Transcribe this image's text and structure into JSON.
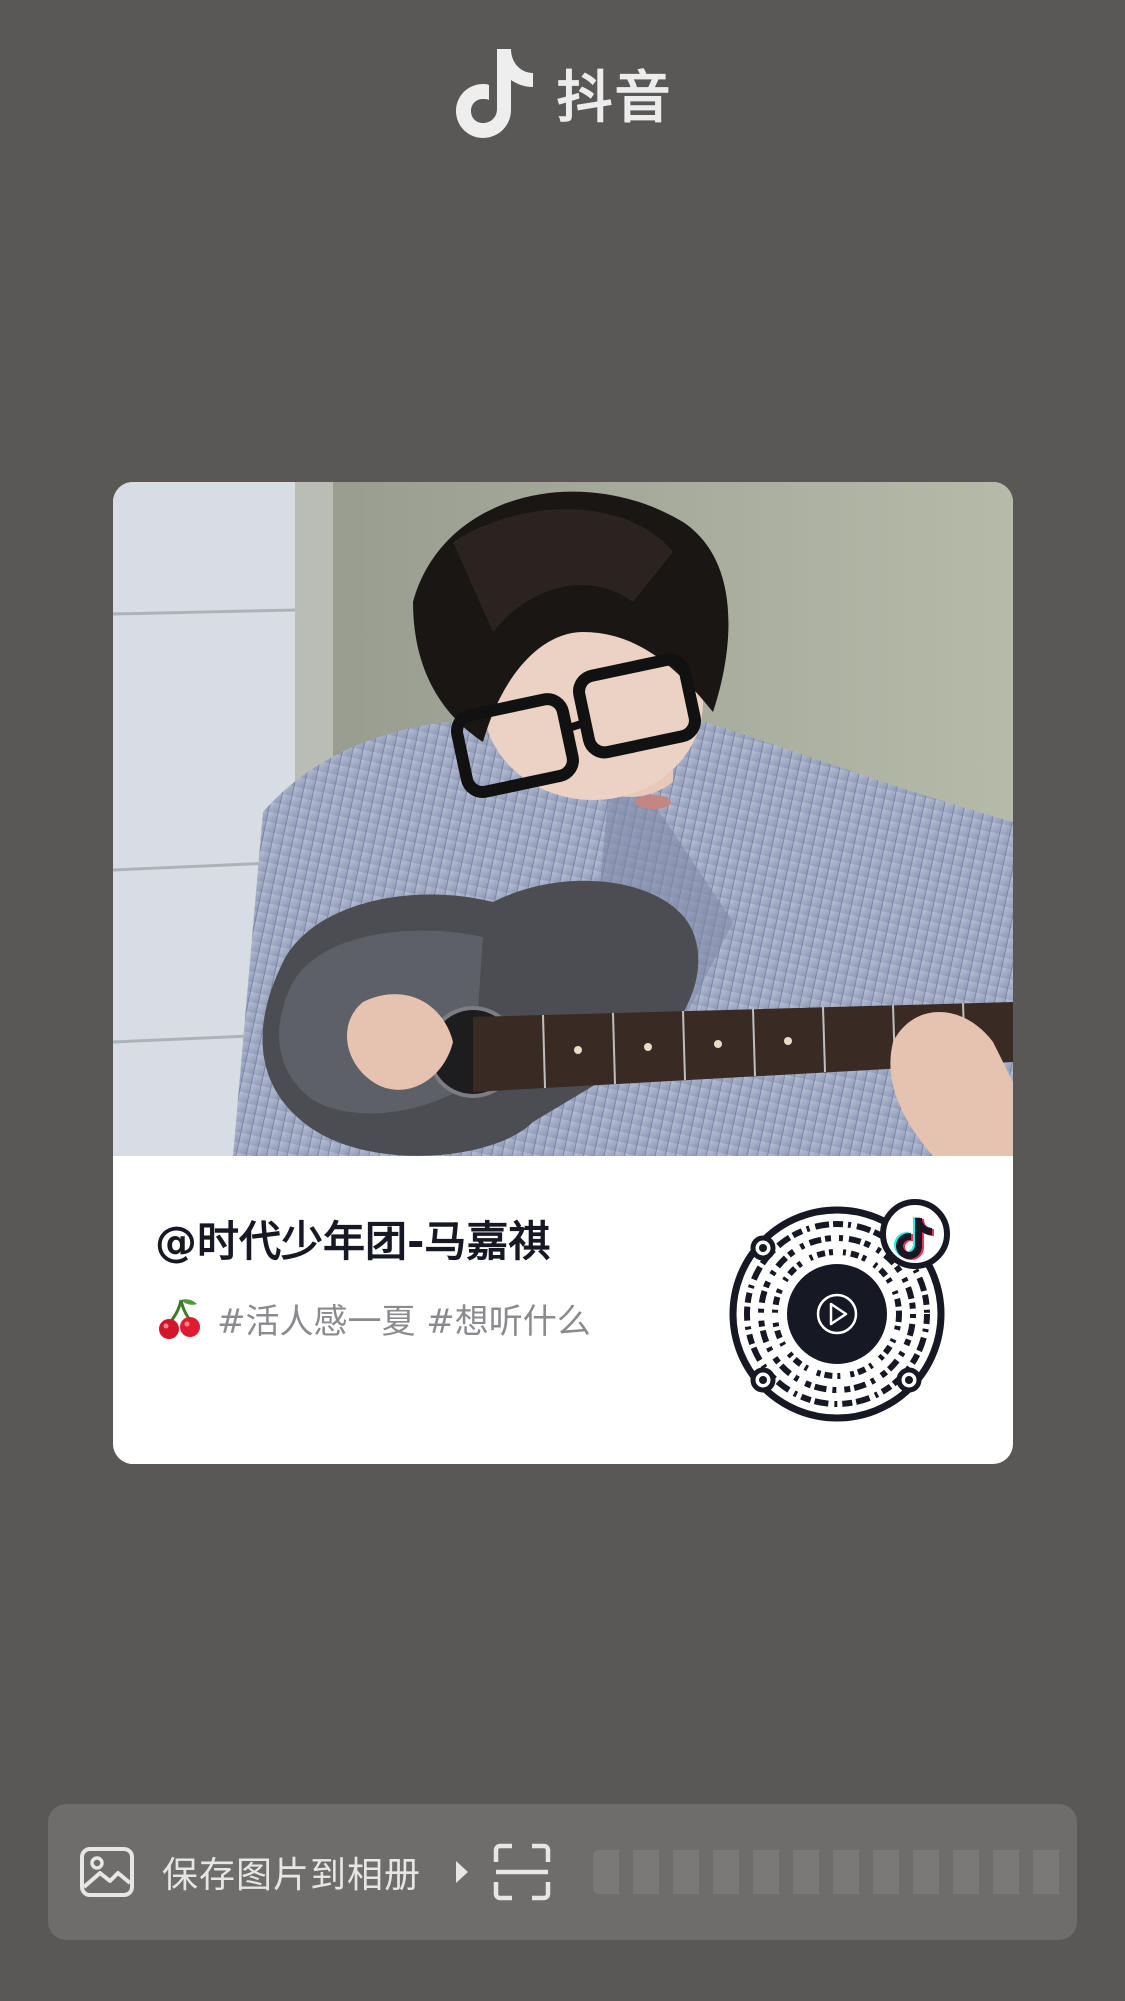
{
  "header": {
    "app_name": "抖音",
    "logo_icon": "douyin-note-icon"
  },
  "card": {
    "photo": "man-playing-guitar-photo",
    "author": "@时代少年团-马嘉祺",
    "emoji_icon": "cherry-icon",
    "hashtags": "#活人感一夏 #想听什么",
    "qr_icon": "qr-code-icon",
    "qr_badge_icon": "douyin-note-icon",
    "qr_center_icon": "play-icon"
  },
  "action_bar": {
    "save_label": "保存图片到相册",
    "save_icon": "image-icon",
    "arrow_icon": "triangle-right-icon",
    "scan_icon": "scan-icon"
  },
  "colors": {
    "background": "#5a5856",
    "card": "#ffffff",
    "author_text": "#161823",
    "hashtag_text": "#8b8b8f",
    "action_bar": "#6e6d6b"
  }
}
